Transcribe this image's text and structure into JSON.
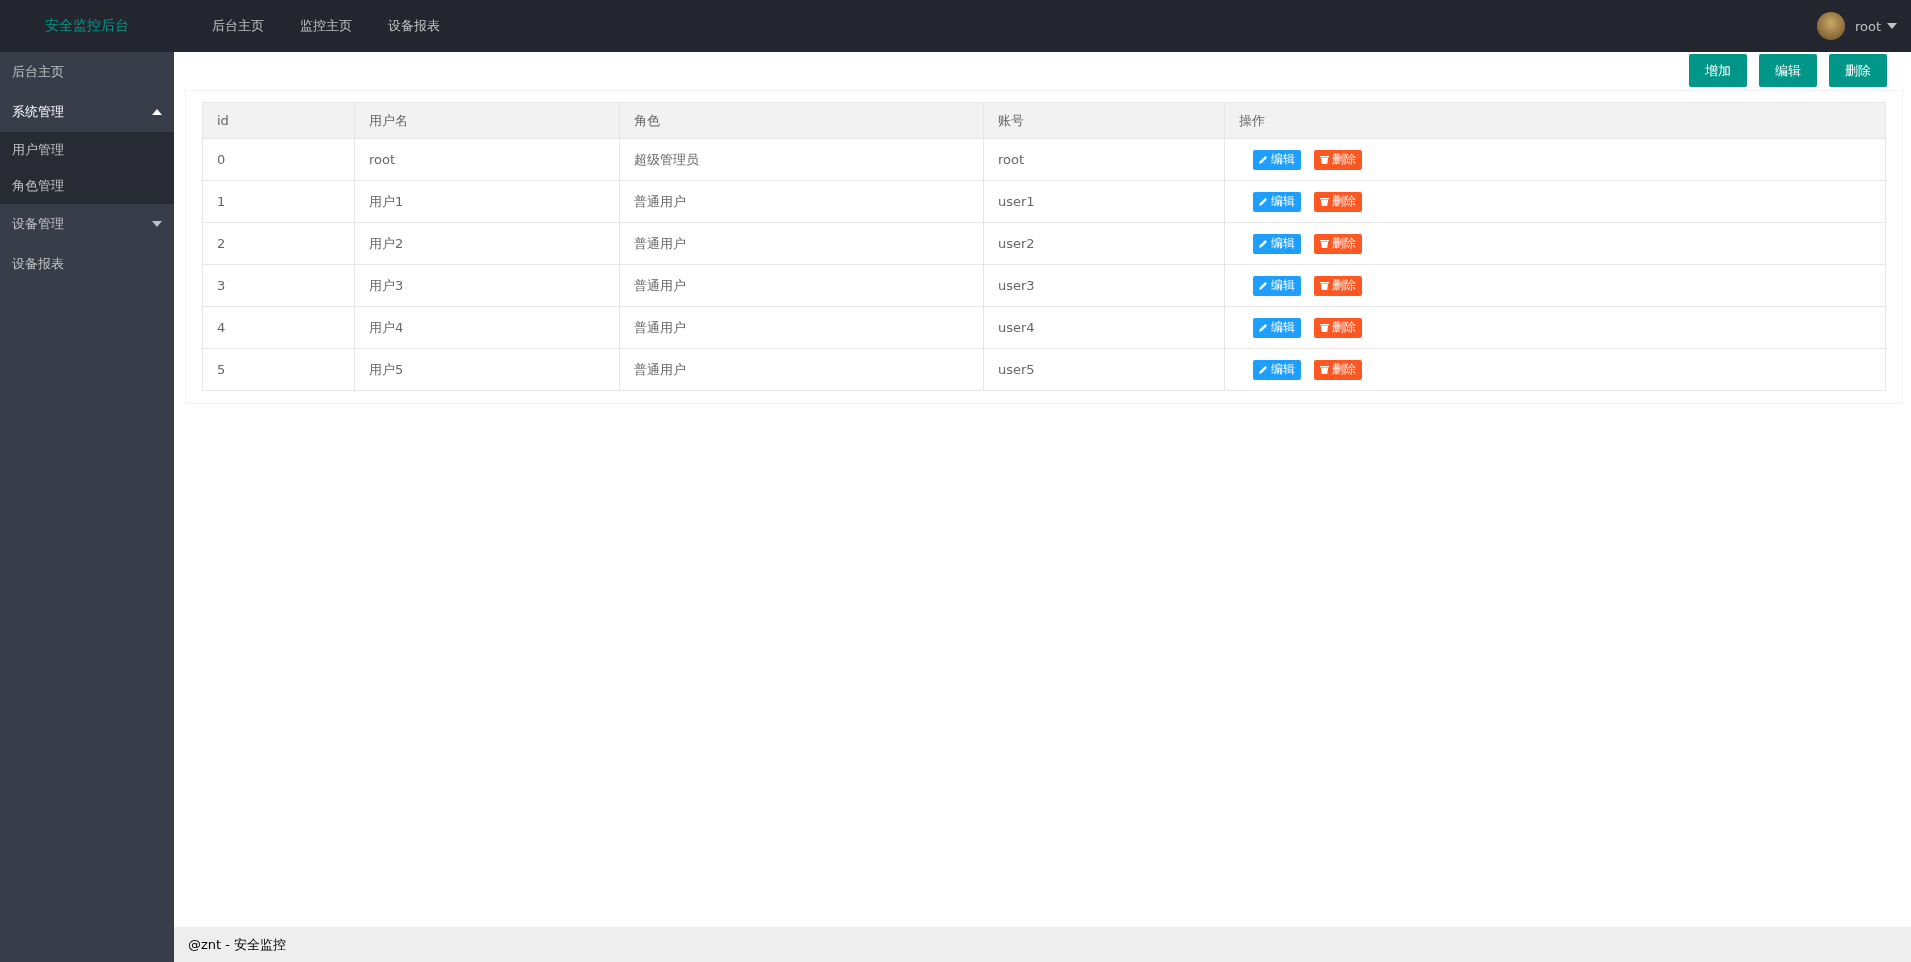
{
  "header": {
    "logo": "安全监控后台",
    "nav": [
      {
        "label": "后台主页"
      },
      {
        "label": "监控主页"
      },
      {
        "label": "设备报表"
      }
    ],
    "user": {
      "name": "root"
    }
  },
  "sidebar": {
    "items": [
      {
        "label": "后台主页"
      },
      {
        "label": "系统管理",
        "expanded": true,
        "children": [
          {
            "label": "用户管理"
          },
          {
            "label": "角色管理"
          }
        ]
      },
      {
        "label": "设备管理",
        "expanded": false
      },
      {
        "label": "设备报表"
      }
    ]
  },
  "toolbar": {
    "buttons": [
      "增加",
      "编辑",
      "删除"
    ]
  },
  "table": {
    "columns": [
      "id",
      "用户名",
      "角色",
      "账号",
      "操作"
    ],
    "rows": [
      {
        "cells": [
          "0",
          "root",
          "超级管理员",
          "root"
        ],
        "actions": [
          "编辑",
          "删除"
        ]
      },
      {
        "cells": [
          "1",
          "用户1",
          "普通用户",
          "user1"
        ],
        "actions": [
          "编辑",
          "删除"
        ]
      },
      {
        "cells": [
          "2",
          "用户2",
          "普通用户",
          "user2"
        ],
        "actions": [
          "编辑",
          "删除"
        ]
      },
      {
        "cells": [
          "3",
          "用户3",
          "普通用户",
          "user3"
        ],
        "actions": [
          "编辑",
          "删除"
        ]
      },
      {
        "cells": [
          "4",
          "用户4",
          "普通用户",
          "user4"
        ],
        "actions": [
          "编辑",
          "删除"
        ]
      },
      {
        "cells": [
          "5",
          "用户5",
          "普通用户",
          "user5"
        ],
        "actions": [
          "编辑",
          "删除"
        ]
      }
    ]
  },
  "footer": {
    "text": "@znt - 安全监控"
  }
}
